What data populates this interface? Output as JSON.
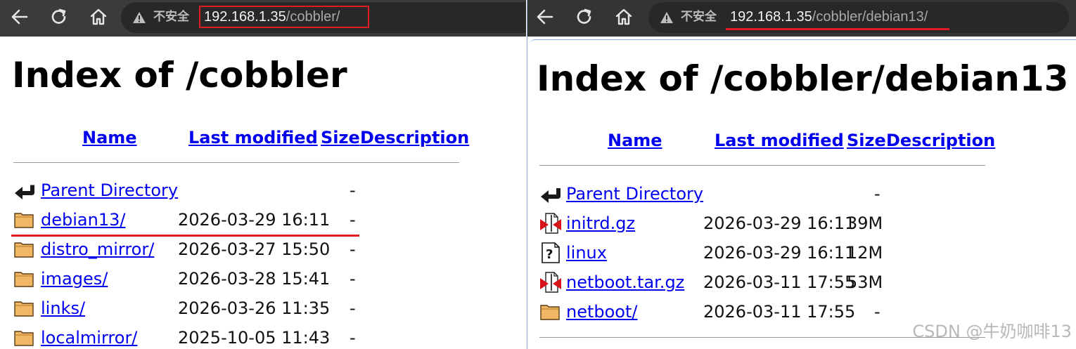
{
  "colors": {
    "link": "#0000ee",
    "annotation_red": "#e01b24",
    "toolbar": "#3b3b3b"
  },
  "left": {
    "insecure_label": "不安全",
    "url_host": "192.168.1.35",
    "url_path": "/cobbler/",
    "heading": "Index of /cobbler",
    "columns": {
      "name": "Name",
      "last_modified": "Last modified",
      "size": "Size",
      "description": "Description"
    },
    "entries": [
      {
        "icon": "back-icon",
        "name": "Parent Directory",
        "date": "",
        "size": "-"
      },
      {
        "icon": "folder-icon",
        "name": "debian13/",
        "date": "2026-03-29 16:11",
        "size": "-"
      },
      {
        "icon": "folder-icon",
        "name": "distro_mirror/",
        "date": "2026-03-27 15:50",
        "size": "-"
      },
      {
        "icon": "folder-icon",
        "name": "images/",
        "date": "2026-03-28 15:41",
        "size": "-"
      },
      {
        "icon": "folder-icon",
        "name": "links/",
        "date": "2026-03-26 11:35",
        "size": "-"
      },
      {
        "icon": "folder-icon",
        "name": "localmirror/",
        "date": "2025-10-05 11:43",
        "size": "-"
      }
    ]
  },
  "right": {
    "insecure_label": "不安全",
    "url_host": "192.168.1.35",
    "url_path": "/cobbler/debian13/",
    "heading": "Index of /cobbler/debian13",
    "columns": {
      "name": "Name",
      "last_modified": "Last modified",
      "size": "Size",
      "description": "Description"
    },
    "entries": [
      {
        "icon": "back-icon",
        "name": "Parent Directory",
        "date": "",
        "size": "-"
      },
      {
        "icon": "compressed-icon",
        "name": "initrd.gz",
        "date": "2026-03-29 16:11",
        "size": "39M"
      },
      {
        "icon": "unknown-icon",
        "name": "linux",
        "date": "2026-03-29 16:11",
        "size": "12M"
      },
      {
        "icon": "compressed-icon",
        "name": "netboot.tar.gz",
        "date": "2026-03-11 17:55",
        "size": "53M"
      },
      {
        "icon": "folder-icon",
        "name": "netboot/",
        "date": "2026-03-11 17:55",
        "size": "-"
      }
    ]
  },
  "watermark": "CSDN @牛奶咖啡13"
}
